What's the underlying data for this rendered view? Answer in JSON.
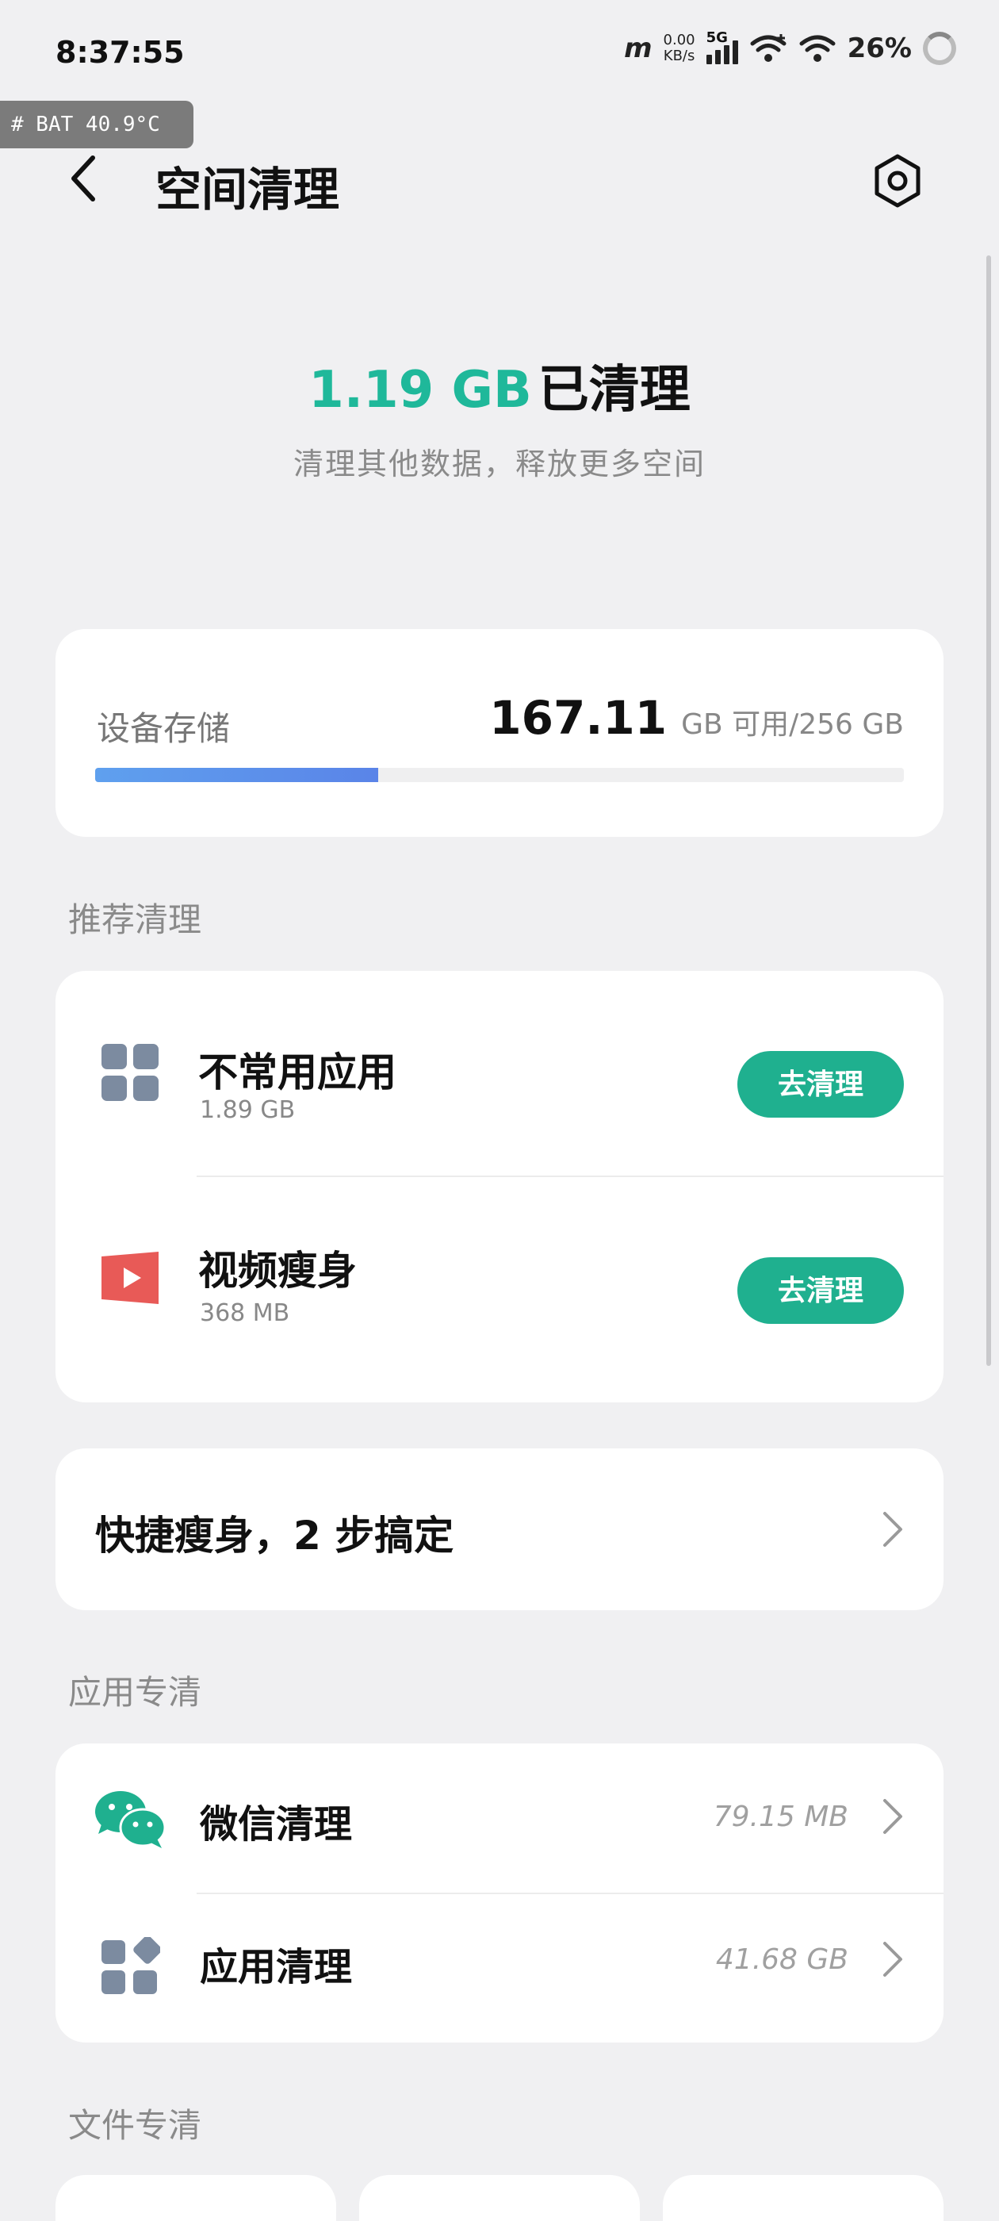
{
  "status_bar": {
    "time": "8:37:55",
    "carrier_glyph": "m",
    "speed_value": "0.00",
    "speed_unit": "KB/s",
    "network": "5G",
    "battery": "26%",
    "icons": [
      "signal-icon",
      "wifi-calling-icon",
      "wifi-icon",
      "battery-ring-icon"
    ]
  },
  "overlay": {
    "bat_temp": "# BAT 40.9°C"
  },
  "header": {
    "title": "空间清理",
    "back_icon": "chevron-left-icon",
    "settings_icon": "settings-hexagon-icon"
  },
  "hero": {
    "cleaned_amount": "1.19 GB",
    "cleaned_label": "已清理",
    "subtitle": "清理其他数据，释放更多空间"
  },
  "storage": {
    "label": "设备存储",
    "free": "167.11",
    "total_text": "GB 可用/256 GB",
    "used_fraction": 0.35,
    "fill_color": "#5a8fec"
  },
  "recommend": {
    "title": "推荐清理",
    "items": [
      {
        "name": "不常用应用",
        "size": "1.89 GB",
        "button": "去清理",
        "icon": "apps-grid-icon"
      },
      {
        "name": "视频瘦身",
        "size": "368 MB",
        "button": "去清理",
        "icon": "video-play-icon"
      }
    ],
    "accent": "#1fb08f"
  },
  "quick": {
    "label": "快捷瘦身，2 步搞定"
  },
  "app_clean": {
    "title": "应用专清",
    "items": [
      {
        "name": "微信清理",
        "size": "79.15 MB",
        "icon": "wechat-icon"
      },
      {
        "name": "应用清理",
        "size": "41.68 GB",
        "icon": "app-diamond-grid-icon"
      }
    ]
  },
  "file_clean": {
    "title": "文件专清"
  }
}
